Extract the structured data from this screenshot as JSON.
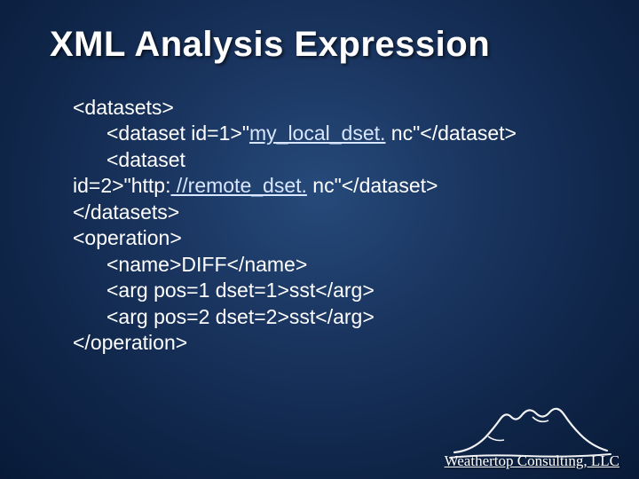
{
  "title": "XML Analysis Expression",
  "code": {
    "l1": "<datasets>",
    "l2_pre": "<dataset id=1>\"",
    "l2_link": "my_local_dset.",
    "l2_post": " nc\"</dataset>",
    "l3": "<dataset",
    "l4_pre": "id=2>\"http:",
    "l4_link": " //remote_dset.",
    "l4_post": " nc\"</dataset>",
    "l5": "</datasets>",
    "l6": "<operation>",
    "l7": "<name>DIFF</name>",
    "l8": "<arg pos=1 dset=1>sst</arg>",
    "l9": "<arg pos=2 dset=2>sst</arg>",
    "l10": "</operation>"
  },
  "footer": "Weathertop Consulting, LLC"
}
